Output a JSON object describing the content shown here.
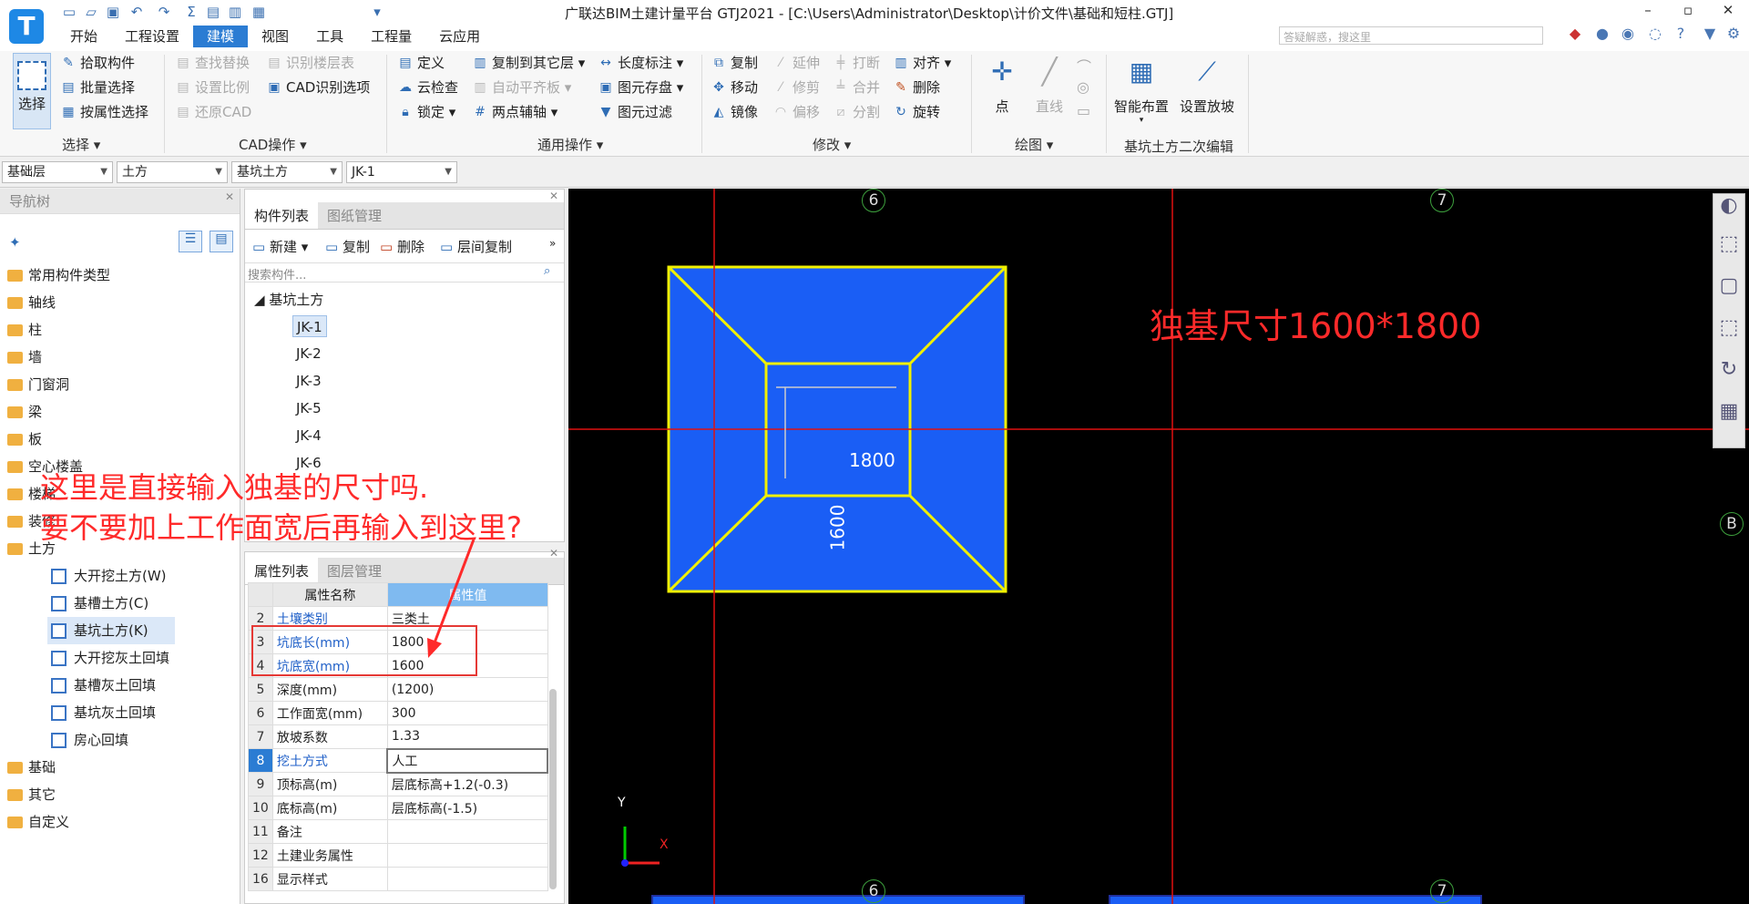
{
  "app": {
    "title": "广联达BIM土建计量平台 GTJ2021 - [C:\\Users\\Administrator\\Desktop\\计价文件\\基础和短柱.GTJ]",
    "logo": "T"
  },
  "menu_tabs": [
    "开始",
    "工程设置",
    "建模",
    "视图",
    "工具",
    "工程量",
    "云应用"
  ],
  "active_tab": "建模",
  "search": {
    "placeholder": "答疑解惑，搜这里"
  },
  "window_controls": {
    "min": "–",
    "max": "▫",
    "close": "✕"
  },
  "ribbon": {
    "select": {
      "big": "选择",
      "items": [
        "拾取构件",
        "批量选择",
        "按属性选择"
      ],
      "group": "选择"
    },
    "cad": {
      "items": [
        "查找替换",
        "设置比例",
        "还原CAD",
        "识别楼层表",
        "CAD识别选项"
      ],
      "group": "CAD操作"
    },
    "general": {
      "items": [
        "定义",
        "云检查",
        "锁定",
        "复制到其它层",
        "自动平齐板",
        "两点辅轴",
        "长度标注",
        "图元存盘",
        "图元过滤"
      ],
      "group": "通用操作"
    },
    "modify": {
      "items": [
        "复制",
        "移动",
        "镜像",
        "延伸",
        "修剪",
        "偏移",
        "打断",
        "合并",
        "分割",
        "对齐",
        "删除",
        "旋转"
      ],
      "group": "修改"
    },
    "draw": {
      "items": [
        "点",
        "直线"
      ],
      "group": "绘图"
    },
    "pit": {
      "items": [
        "智能布置",
        "设置放坡"
      ],
      "group": "基坑土方二次编辑"
    }
  },
  "combos": [
    "基础层",
    "土方",
    "基坑土方",
    "JK-1"
  ],
  "nav": {
    "title": "导航树",
    "items": [
      "常用构件类型",
      "轴线",
      "柱",
      "墙",
      "门窗洞",
      "梁",
      "板",
      "空心楼盖",
      "楼梯",
      "装修",
      "土方"
    ],
    "sub_items": [
      "大开挖土方(W)",
      "基槽土方(C)",
      "基坑土方(K)",
      "大开挖灰土回填",
      "基槽灰土回填",
      "基坑灰土回填",
      "房心回填"
    ],
    "selected_sub": "基坑土方(K)",
    "bottom_items": [
      "基础",
      "其它",
      "自定义"
    ]
  },
  "components": {
    "tabs": [
      "构件列表",
      "图纸管理"
    ],
    "toolbar": [
      "新建",
      "复制",
      "删除",
      "层间复制"
    ],
    "search_placeholder": "搜索构件...",
    "group": "基坑土方",
    "items": [
      "JK-1",
      "JK-2",
      "JK-3",
      "JK-5",
      "JK-4",
      "JK-6"
    ],
    "selected": "JK-1"
  },
  "props": {
    "tabs": [
      "属性列表",
      "图层管理"
    ],
    "headers": [
      "属性名称",
      "属性值"
    ],
    "rows": [
      {
        "n": "2",
        "name": "土壤类别",
        "val": "三类土",
        "blue": true
      },
      {
        "n": "3",
        "name": "坑底长(mm)",
        "val": "1800",
        "blue": true
      },
      {
        "n": "4",
        "name": "坑底宽(mm)",
        "val": "1600",
        "blue": true
      },
      {
        "n": "5",
        "name": "深度(mm)",
        "val": "(1200)",
        "blue": false
      },
      {
        "n": "6",
        "name": "工作面宽(mm)",
        "val": "300",
        "blue": false
      },
      {
        "n": "7",
        "name": "放坡系数",
        "val": "1.33",
        "blue": false
      },
      {
        "n": "8",
        "name": "挖土方式",
        "val": "人工",
        "blue": true
      },
      {
        "n": "9",
        "name": "顶标高(m)",
        "val": "层底标高+1.2(-0.3)",
        "blue": false
      },
      {
        "n": "10",
        "name": "底标高(m)",
        "val": "层底标高(-1.5)",
        "blue": false
      },
      {
        "n": "11",
        "name": "备注",
        "val": "",
        "blue": false
      },
      {
        "n": "12",
        "name": "土建业务属性",
        "val": "",
        "blue": false
      },
      {
        "n": "16",
        "name": "显示样式",
        "val": "",
        "blue": false
      }
    ]
  },
  "canvas": {
    "axis_top": [
      "6",
      "7"
    ],
    "axis_side": "B",
    "dim_length": "1800",
    "dim_width": "1600",
    "label": "独基尺寸1600*1800",
    "coord_x": "X",
    "coord_y": "Y",
    "fill": "#1a5ef5",
    "outline": "#f0f000",
    "axisline": "#e01010"
  },
  "annotation": {
    "line1": "这里是直接输入独基的尺寸吗.",
    "line2": "要不要加上工作面宽后再输入到这里?"
  }
}
